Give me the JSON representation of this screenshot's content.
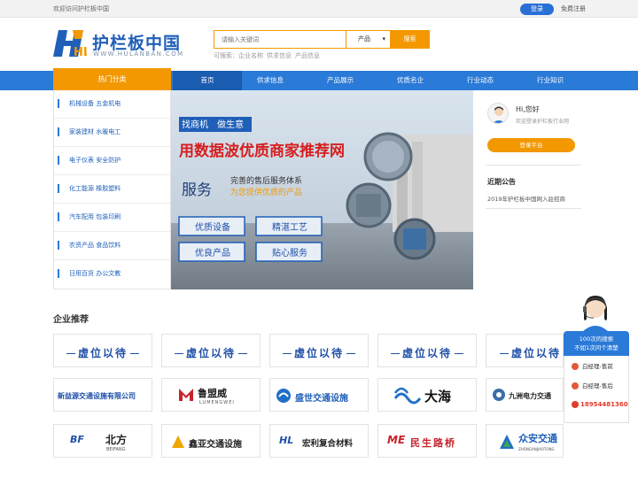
{
  "topbar": {
    "welcome": "欢迎访问护栏板中国",
    "login": "登录",
    "register": "免费注册"
  },
  "logo": {
    "cn": "护栏板中国",
    "en": "WWW.HULANBAN.COM",
    "mark": "HL"
  },
  "search": {
    "placeholder": "请输入关键词",
    "type": "产品",
    "button": "搜索",
    "hot_label": "可搜索：",
    "hot": [
      "企业名称",
      "供求信息",
      "产品信息"
    ]
  },
  "nav": {
    "category": "热门分类",
    "items": [
      "首页",
      "供求信息",
      "产品展示",
      "优质名企",
      "行业动态",
      "行业知识"
    ]
  },
  "sidebar": [
    "机械设备 五金机电",
    "家装建材 水暖电工",
    "电子仪表 安全防护",
    "化工能源 橡胶塑料",
    "汽车配用 包装印刷",
    "农资产品 食品饮料",
    "日用百货 办公文教"
  ],
  "banner": {
    "tag1": "找商机",
    "tag2": "做生意",
    "headline": "用数据波优质商家推荐网",
    "service": "服务",
    "line1": "完善的售后服务体系",
    "line2": "为您提供优质的产品",
    "buttons": [
      "优质设备",
      "精湛工艺",
      "优良产品",
      "贴心服务"
    ]
  },
  "user_panel": {
    "hi": "Hi,您好",
    "sub": "欢迎登录护栏板行业网",
    "login_btn": "登录平台",
    "announce_title": "近期公告",
    "announce": "2019年护栏板中国网入驻招商"
  },
  "recommend": {
    "title": "企业推荐",
    "placeholder": "虚位以待",
    "row2": [
      "新益源交通设施有限公司",
      "鲁盟威",
      "盛世交通设施",
      "大海",
      "九洲电力交通"
    ],
    "row2_sub": {
      "lumengwei": "LUMENGWEI"
    },
    "row3": [
      "北方",
      "鑫亚交通设施",
      "宏利复合材料",
      "民生路桥",
      "众安交通"
    ],
    "row3_sub": {
      "beifang": "BEIFANG",
      "zhongan": "ZHONGANJIAOTONG",
      "bf": "BF",
      "hl": "HL",
      "me": "ME"
    }
  },
  "customer_service": {
    "line1": "100次的搜索",
    "line2": "不如1次问个清楚",
    "agents": [
      "白经理-售前",
      "白经理-售后"
    ],
    "phone": "18954481360"
  },
  "colors": {
    "primary": "#2a7ad8",
    "accent": "#f39800",
    "brand": "#1f5fb8"
  }
}
